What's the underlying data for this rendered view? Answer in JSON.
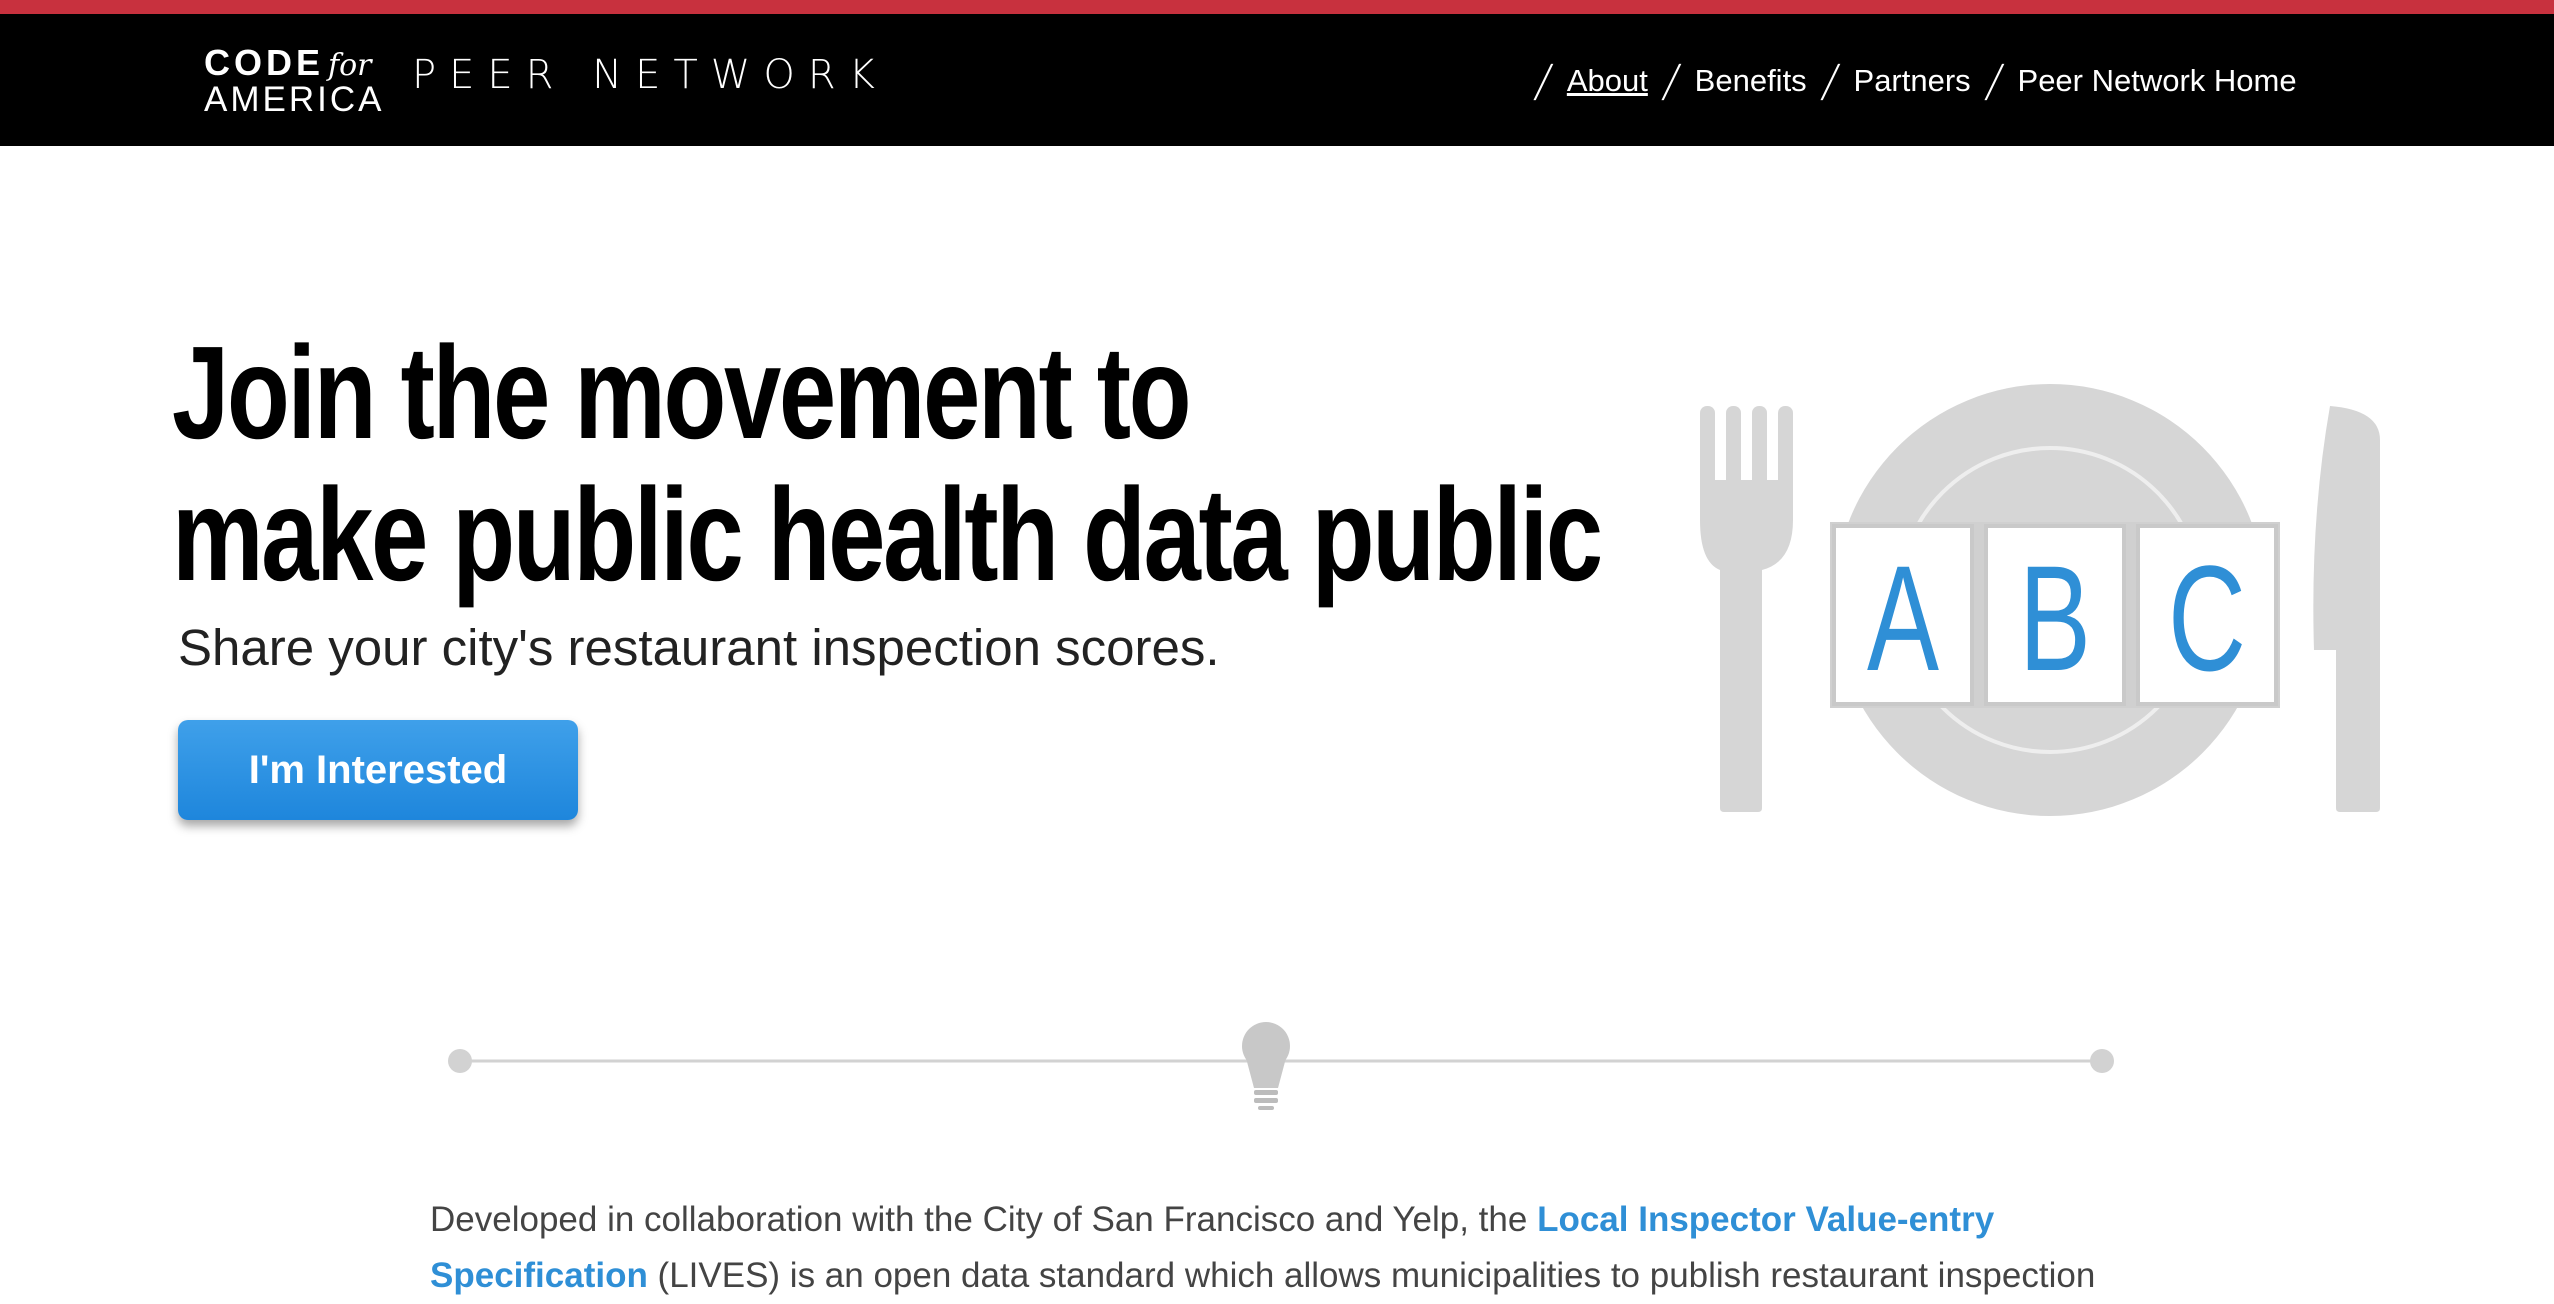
{
  "header": {
    "logo_code": "CODE",
    "logo_for": "for",
    "logo_america": "AMERICA",
    "logo_sub": "PEER NETWORK",
    "nav": [
      {
        "label": "About",
        "active": true
      },
      {
        "label": "Benefits"
      },
      {
        "label": "Partners"
      },
      {
        "label": "Peer Network Home"
      }
    ],
    "nav_separator": "/"
  },
  "hero": {
    "title_line1": "Join the movement to",
    "title_line2": "make public health data public",
    "subtitle": "Share your city's restaurant inspection scores.",
    "cta_label": "I'm Interested",
    "grades": [
      "A",
      "B",
      "C"
    ]
  },
  "body": {
    "intro_before_link": "Developed in collaboration with the City of San Francisco and Yelp, the ",
    "link_text": "Local Inspector Value-entry Specification",
    "intro_after_link": " (LIVES) is an open data standard which allows municipalities to publish restaurant inspection"
  },
  "colors": {
    "top_stripe": "#c8313e",
    "header_bg": "#000000",
    "accent_blue": "#2f8fd6",
    "illustration_gray": "#d6d6d6"
  },
  "icons": [
    "fork-icon",
    "plate-icon",
    "knife-icon",
    "lightbulb-icon"
  ]
}
